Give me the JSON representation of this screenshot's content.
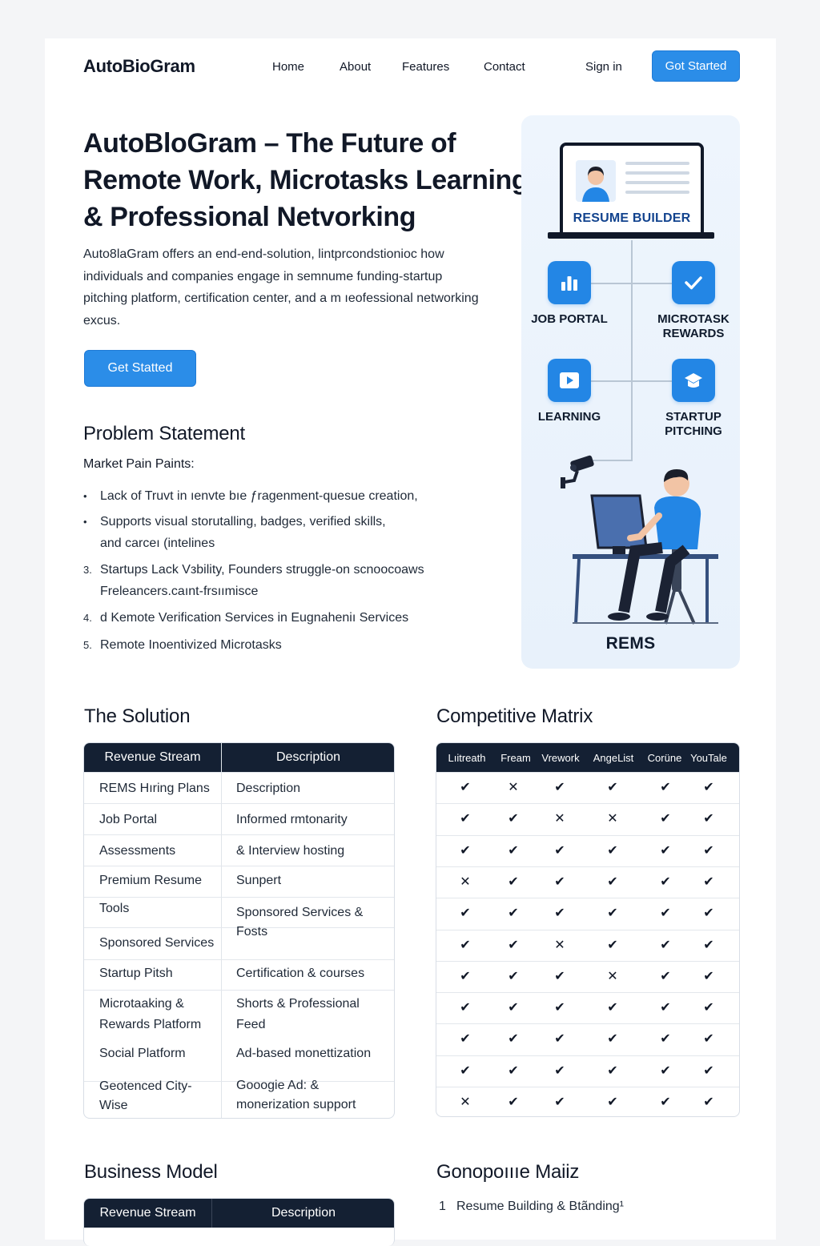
{
  "header": {
    "logo": "AutoBioGram",
    "nav": [
      "Home",
      "About",
      "Features",
      "Contact"
    ],
    "sign_in": "Sign in",
    "cta": "Got Started"
  },
  "hero": {
    "title": "AutoBloGram – The Future of Remote Work, Microtasks Learning & Professional Netvorking",
    "description": "Auto8laGram offers an end-end-solution, lintprcondstionioc how individuals and companies engage in semnume funding-startup pitching platform, certification center, and a m ıeofessional networking excus.",
    "cta": "Get Statted"
  },
  "illustration": {
    "resume_builder": "RESUME BUILDER",
    "job_portal": "JOB PORTAL",
    "microtask_rewards": "MICROTASK REWARDS",
    "learning": "LEARNING",
    "startup_pitching": "STARTUP PITCHING",
    "footer_label": "REMS"
  },
  "problem": {
    "heading": "Problem Statement",
    "subheading": "Market Pain Paints:",
    "items": [
      {
        "marker": "•",
        "text": "Lack of Truvt in ıenvte bıe ƒragenment-quesue creation,"
      },
      {
        "marker": "•",
        "text": "Supports visual storutalling, badges, verified skills, and carceı (intelines"
      },
      {
        "marker": "3.",
        "text": "Startups Lack Vзbility, Founders struggle-on scnoocoaws Freleancers.caınt-frsıımisce"
      },
      {
        "marker": "4.",
        "text": "d Kemote Verification Services in Eugnaheniı Services"
      },
      {
        "marker": "5.",
        "text": "Remote Inoentivized Microtasks"
      }
    ]
  },
  "solution": {
    "heading": "The Solution",
    "columns": [
      "Revenue Stream",
      "Description"
    ],
    "rows": [
      [
        "REMS Hıring Plans",
        "Description"
      ],
      [
        "Job Portal",
        "Informed rmtonarity"
      ],
      [
        "Assessments",
        "& Interview hosting"
      ],
      [
        "Premium Resume",
        "Sunpert"
      ],
      [
        "Tools",
        "Sponsored Services & Fosts"
      ],
      [
        "Sponsored Services",
        ""
      ],
      [
        "Startup Pitsh",
        "Certification & courses"
      ],
      [
        "Microtaaking & Rewards Platform",
        "Shorts & Professional Feed"
      ],
      [
        "Social Platform",
        "Ad-based monettization"
      ],
      [
        "Geotenced City-Wise",
        "Gooogie Ad: & monerization support"
      ]
    ]
  },
  "matrix": {
    "heading": "Competitive Matrix",
    "columns": [
      "Lıitreath",
      "Fream",
      "Vrework",
      "AngeList",
      "Corüne",
      "YouTale"
    ],
    "rows": [
      [
        "✔",
        "✕",
        "✔",
        "✔",
        "✔",
        "✔"
      ],
      [
        "✔",
        "✔",
        "✕",
        "✕",
        "✔",
        "✔"
      ],
      [
        "✔",
        "✔",
        "✔",
        "✔",
        "✔",
        "✔"
      ],
      [
        "✕",
        "✔",
        "✔",
        "✔",
        "✔",
        "✔"
      ],
      [
        "✔",
        "✔",
        "✔",
        "✔",
        "✔",
        "✔"
      ],
      [
        "✔",
        "✔",
        "✕",
        "✔",
        "✔",
        "✔"
      ],
      [
        "✔",
        "✔",
        "✔",
        "✕",
        "✔",
        "✔"
      ],
      [
        "✔",
        "✔",
        "✔",
        "✔",
        "✔",
        "✔"
      ],
      [
        "✔",
        "✔",
        "✔",
        "✔",
        "✔",
        "✔"
      ],
      [
        "✔",
        "✔",
        "✔",
        "✔",
        "✔",
        "✔"
      ],
      [
        "✕",
        "✔",
        "✔",
        "✔",
        "✔",
        "✔"
      ]
    ]
  },
  "business_model": {
    "heading": "Business Model",
    "columns": [
      "Revenue Stream",
      "Description"
    ]
  },
  "gmatrix": {
    "heading": "Gonopoıııe Maiiz",
    "items": [
      {
        "num": "1",
        "text": "Resume Building & Btãnding¹"
      }
    ]
  },
  "colors": {
    "accent": "#2b8de8",
    "dark": "#142033",
    "icon_tile": "#2386e5",
    "panel": "#eef5fd"
  }
}
